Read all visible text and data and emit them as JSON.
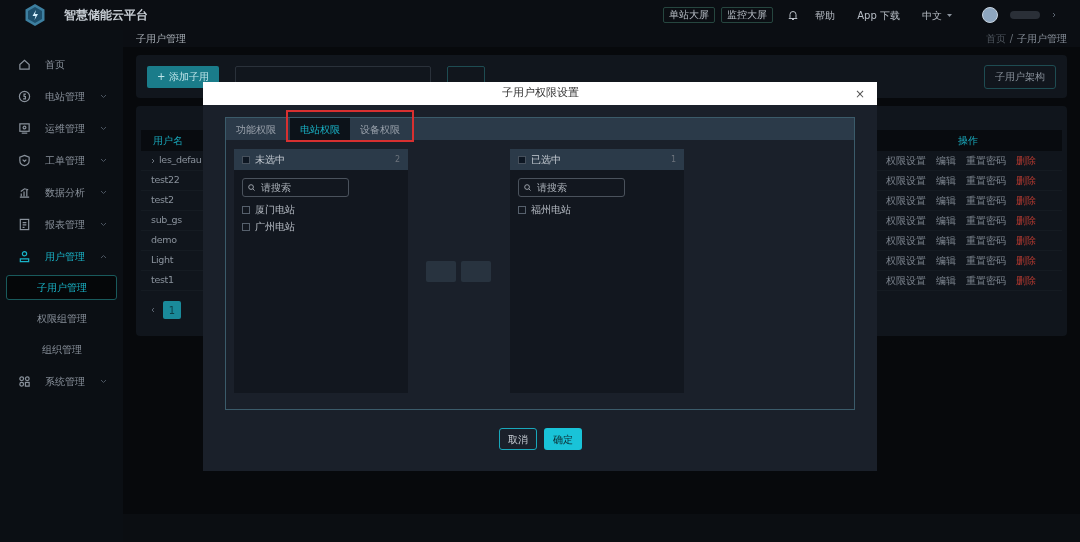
{
  "header": {
    "title": "智慧储能云平台",
    "buttons": [
      "单站大屏",
      "监控大屏"
    ],
    "links": [
      "帮助",
      "App 下载"
    ],
    "language": "中文"
  },
  "sidebar": {
    "items": [
      {
        "label": "首页",
        "selected": false
      },
      {
        "label": "电站管理",
        "selected": false,
        "expanded": false
      },
      {
        "label": "运维管理",
        "selected": false,
        "expanded": false
      },
      {
        "label": "工单管理",
        "selected": false,
        "expanded": false
      },
      {
        "label": "数据分析",
        "selected": false,
        "expanded": false
      },
      {
        "label": "报表管理",
        "selected": false,
        "expanded": false
      },
      {
        "label": "用户管理",
        "selected": true,
        "expanded": true,
        "children": [
          {
            "label": "子用户管理",
            "selected": true
          },
          {
            "label": "权限组管理",
            "selected": false
          },
          {
            "label": "组织管理",
            "selected": false
          }
        ]
      },
      {
        "label": "系统管理",
        "selected": false,
        "expanded": false
      }
    ]
  },
  "breadcrumb": {
    "title": "子用户管理",
    "path": [
      "首页",
      "子用户管理"
    ],
    "separator": "/"
  },
  "toolbar": {
    "add_button": "+ 添加子用",
    "structure_button": "子用户架构"
  },
  "table": {
    "name_header": "用户名",
    "actions_header": "操作",
    "rows": [
      {
        "name": "les_defau",
        "expandable": true,
        "actions": [
          "权限设置",
          "编辑",
          "重置密码",
          "删除"
        ]
      },
      {
        "name": "test22",
        "expandable": false,
        "actions": [
          "权限设置",
          "编辑",
          "重置密码",
          "删除"
        ]
      },
      {
        "name": "test2",
        "expandable": false,
        "actions": [
          "权限设置",
          "编辑",
          "重置密码",
          "删除"
        ]
      },
      {
        "name": "sub_gs",
        "expandable": false,
        "actions": [
          "权限设置",
          "编辑",
          "重置密码",
          "删除"
        ]
      },
      {
        "name": "demo",
        "expandable": false,
        "actions": [
          "权限设置",
          "编辑",
          "重置密码",
          "删除"
        ]
      },
      {
        "name": "Light",
        "expandable": false,
        "actions": [
          "权限设置",
          "编辑",
          "重置密码",
          "删除"
        ]
      },
      {
        "name": "test1",
        "expandable": false,
        "actions": [
          "权限设置",
          "编辑",
          "重置密码",
          "删除"
        ]
      }
    ]
  },
  "pagination": {
    "pages": [
      {
        "label": "1",
        "selected": true
      }
    ]
  },
  "dialog": {
    "title": "子用户权限设置",
    "close": "×",
    "tabs": [
      {
        "label": "功能权限",
        "selected": false,
        "highlighted": false
      },
      {
        "label": "电站权限",
        "selected": true,
        "highlighted": true
      },
      {
        "label": "设备权限",
        "selected": false,
        "highlighted": true
      }
    ],
    "panels": [
      {
        "title": "未选中",
        "count": "2",
        "checked": false,
        "search_placeholder": "请搜索",
        "items": [
          {
            "label": "厦门电站",
            "checked": false
          },
          {
            "label": "广州电站",
            "checked": false
          }
        ]
      },
      {
        "title": "已选中",
        "count": "1",
        "checked": false,
        "search_placeholder": "请搜索",
        "items": [
          {
            "label": "福州电站",
            "checked": false
          }
        ]
      }
    ],
    "transfer_disabled": true,
    "cancel": "取消",
    "confirm": "确定"
  }
}
